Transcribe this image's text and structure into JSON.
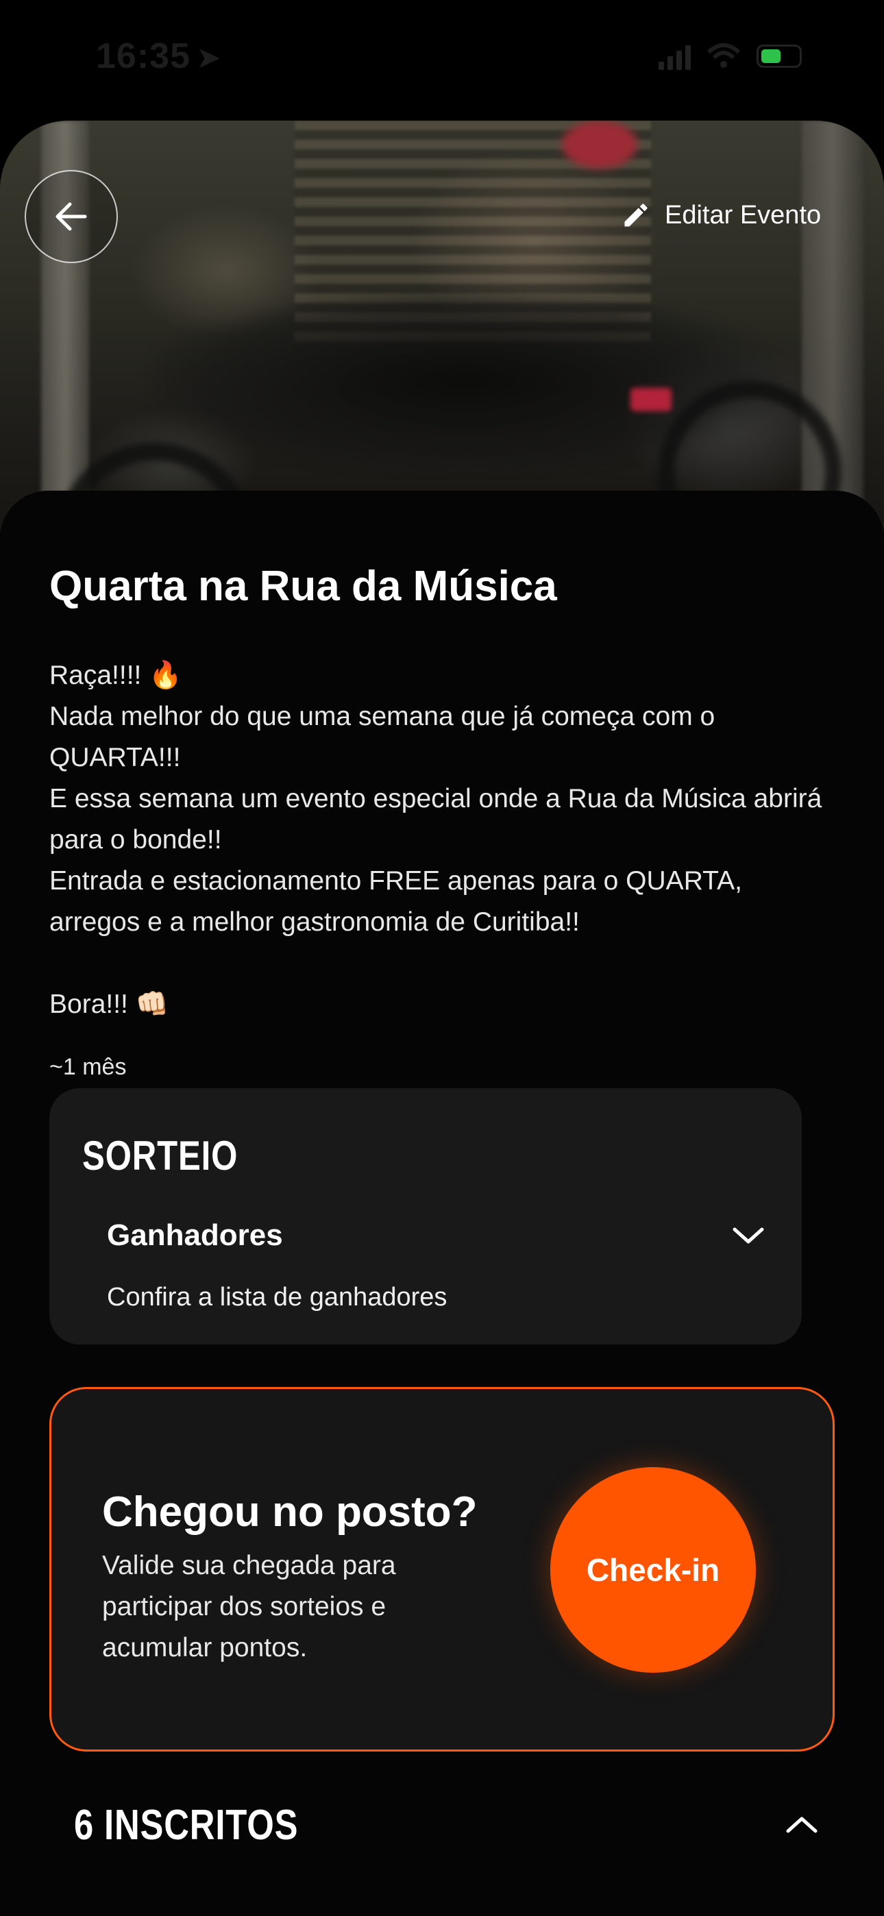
{
  "status_bar": {
    "time": "16:35",
    "location_icon": "location-arrow-icon",
    "signal_icon": "cellular-signal-icon",
    "wifi_icon": "wifi-icon",
    "battery_icon": "battery-charging-icon",
    "battery_color": "#2fc24a"
  },
  "header": {
    "back_icon": "arrow-left-icon",
    "edit_icon": "pencil-icon",
    "edit_label": "Editar Evento"
  },
  "event": {
    "title": "Quarta na Rua da Música",
    "description": {
      "line1": "Raça!!!! 🔥",
      "line2": "Nada melhor do que uma semana que já começa com o QUARTA!!!",
      "line3": "E essa semana um evento especial onde a Rua da Música abrirá para o bonde!!",
      "line4": "Entrada e estacionamento FREE apenas para o QUARTA, arregos e a melhor gastronomia de Curitiba!!",
      "line5": "Bora!!! 👊🏻"
    },
    "time_ago": "~1 mês"
  },
  "raffle": {
    "title": "SORTEIO",
    "winners_label": "Ganhadores",
    "winners_sub": "Confira a lista de ganhadores",
    "expand_icon": "chevron-down-icon"
  },
  "checkin": {
    "title": "Chegou no posto?",
    "text": "Valide sua chegada para participar dos sorteios e acumular pontos.",
    "button_label": "Check-in",
    "accent_color": "#ff5500"
  },
  "subscribers": {
    "label": "6 INSCRITOS",
    "collapse_icon": "chevron-up-icon"
  }
}
